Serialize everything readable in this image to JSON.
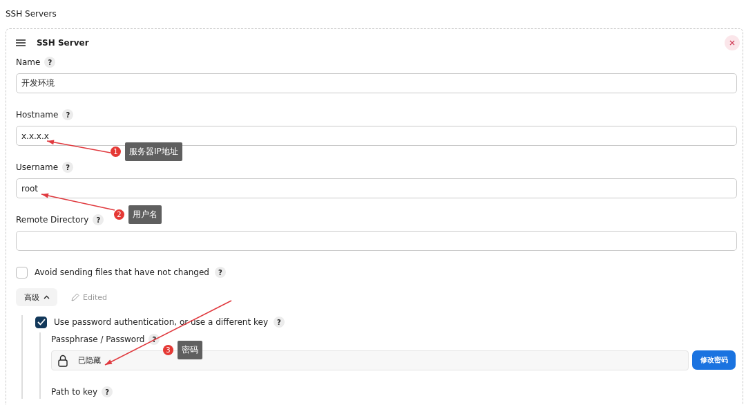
{
  "section_title": "SSH Servers",
  "server": {
    "title": "SSH Server",
    "fields": [
      {
        "label": "Name",
        "help": "?",
        "value": "开发环境"
      },
      {
        "label": "Hostname",
        "help": "?",
        "value": "x.x.x.x"
      },
      {
        "label": "Username",
        "help": "?",
        "value": "root"
      },
      {
        "label": "Remote Directory",
        "help": "?"
      }
    ],
    "avoid_sending": {
      "label": "Avoid sending files that have not changed",
      "help": "?",
      "checked": false
    },
    "advanced": {
      "label": "高级",
      "expanded": true,
      "status": "Edited"
    },
    "password_auth": {
      "label": "Use password authentication, or use a different key",
      "help": "?",
      "checked": true,
      "passphrase": {
        "label": "Passphrase / Password",
        "help": "?",
        "value": "已隐藏",
        "button": "修改密码"
      },
      "path_to_key": {
        "label": "Path to key",
        "help": "?"
      }
    }
  },
  "annotations": [
    {
      "number": "1",
      "text": "服务器IP地址"
    },
    {
      "number": "2",
      "text": "用户名"
    },
    {
      "number": "3",
      "text": "密码"
    }
  ]
}
